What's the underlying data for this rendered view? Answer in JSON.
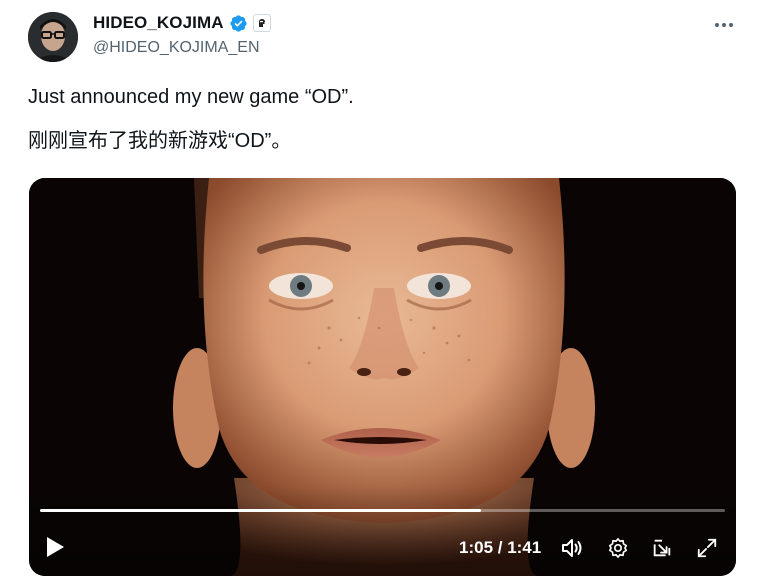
{
  "author": {
    "display_name": "HIDEO_KOJIMA",
    "handle": "@HIDEO_KOJIMA_EN",
    "verified_icon": "verified-badge-icon",
    "affiliate_icon": "affiliate-badge-icon"
  },
  "tweet": {
    "text_en": "Just announced my new game “OD”.",
    "text_zh": "刚刚宣布了我的新游戏“OD”。"
  },
  "video": {
    "current_time": "1:05",
    "duration": "1:41",
    "time_display": "1:05 / 1:41",
    "progress": 0.644,
    "controls": [
      "play-icon",
      "volume-icon",
      "settings-icon",
      "pop-out-icon",
      "fullscreen-icon"
    ]
  },
  "colors": {
    "text_primary": "#0f1419",
    "text_secondary": "#536471",
    "verified_blue": "#1d9bf0",
    "video_background": "#0a0504"
  }
}
